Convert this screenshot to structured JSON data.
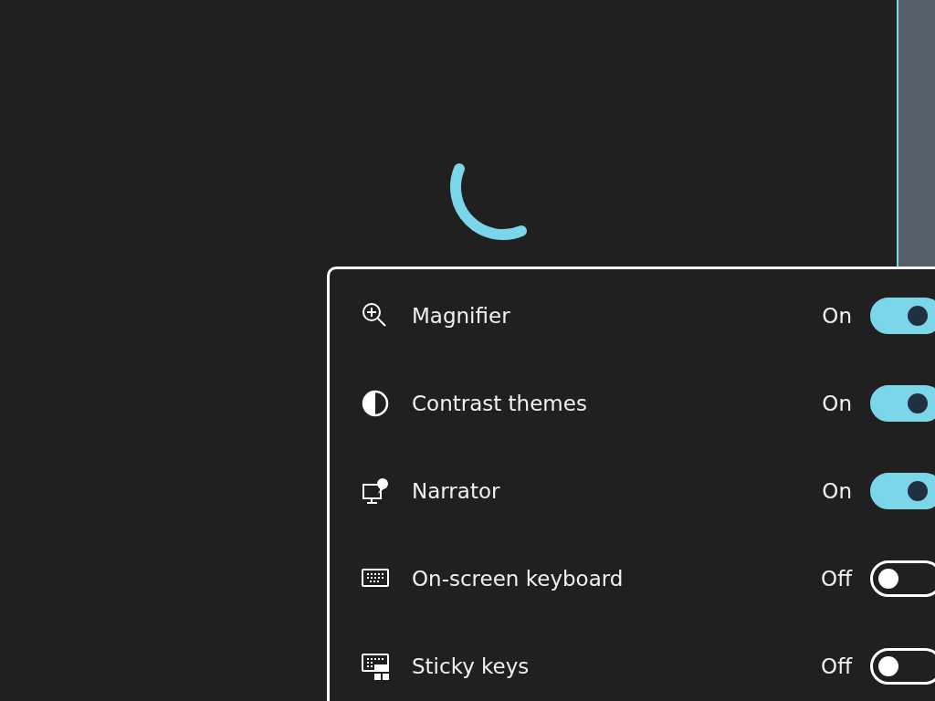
{
  "settings": [
    {
      "kind": "magnifier",
      "label": "Magnifier",
      "status": "On",
      "on": true
    },
    {
      "kind": "contrast",
      "label": "Contrast themes",
      "status": "On",
      "on": true
    },
    {
      "kind": "narrator",
      "label": "Narrator",
      "status": "On",
      "on": true
    },
    {
      "kind": "keyboard",
      "label": "On-screen keyboard",
      "status": "Off",
      "on": false
    },
    {
      "kind": "sticky",
      "label": "Sticky keys",
      "status": "Off",
      "on": false
    }
  ]
}
